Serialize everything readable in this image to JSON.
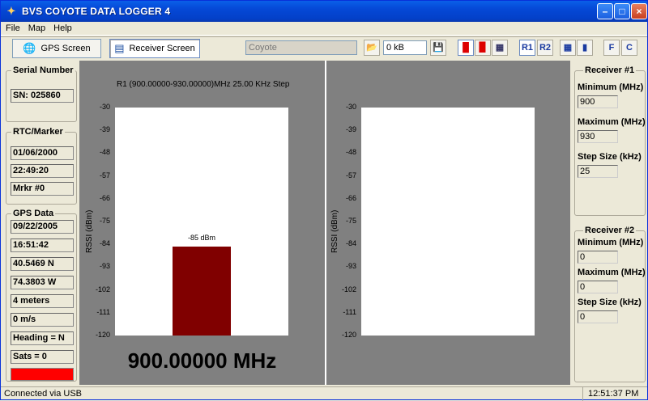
{
  "window": {
    "title": "BVS COYOTE DATA LOGGER 4"
  },
  "menu": [
    "File",
    "Map",
    "Help"
  ],
  "toolbar": {
    "gps_screen": "GPS Screen",
    "receiver_screen": "Receiver Screen",
    "file_field": "Coyote",
    "size_field": "0 kB",
    "r1": "R1",
    "r2": "R2",
    "f": "F",
    "c": "C"
  },
  "left": {
    "serial_title": "Serial Number",
    "serial_value": "SN: 025860",
    "rtc_title": "RTC/Marker",
    "rtc_date": "01/06/2000",
    "rtc_time": "22:49:20",
    "marker": "Mrkr #0",
    "gps_title": "GPS Data",
    "gps_date": "09/22/2005",
    "gps_time": "16:51:42",
    "lat": "40.5469 N",
    "lon": "74.3803 W",
    "alt": "4 meters",
    "speed": "0 m/s",
    "heading": "Heading = N",
    "sats": "Sats = 0"
  },
  "chart_data": [
    {
      "type": "bar",
      "title": "R1 (900.00000-930.00000)MHz 25.00 KHz Step",
      "ylabel": "RSSI (dBm)",
      "yticks": [
        "-30",
        "-39",
        "-48",
        "-57",
        "-66",
        "-75",
        "-84",
        "-93",
        "-102",
        "-111",
        "-120"
      ],
      "ylim": [
        -120,
        -30
      ],
      "values": [
        -85
      ],
      "data_label": "-85 dBm",
      "frequency": "900.00000 MHz"
    },
    {
      "type": "bar",
      "title": "",
      "ylabel": "RSSI (dBm)",
      "yticks": [
        "-30",
        "-39",
        "-48",
        "-57",
        "-66",
        "-75",
        "-84",
        "-93",
        "-102",
        "-111",
        "-120"
      ],
      "ylim": [
        -120,
        -30
      ],
      "values": []
    }
  ],
  "right": {
    "r1_title": "Receiver #1",
    "r1_min_label": "Minimum (MHz)",
    "r1_min": "900",
    "r1_max_label": "Maximum (MHz)",
    "r1_max": "930",
    "r1_step_label": "Step Size (kHz)",
    "r1_step": "25",
    "r2_title": "Receiver #2",
    "r2_min_label": "Minimum (MHz)",
    "r2_min": "0",
    "r2_max_label": "Maximum (MHz)",
    "r2_max": "0",
    "r2_step_label": "Step Size (kHz)",
    "r2_step": "0"
  },
  "status": {
    "connection": "Connected via USB",
    "clock": "12:51:37 PM"
  },
  "colors": {
    "bar": "#800000",
    "gps_fix": "#ff0000",
    "title_bar": "#0548d6"
  }
}
